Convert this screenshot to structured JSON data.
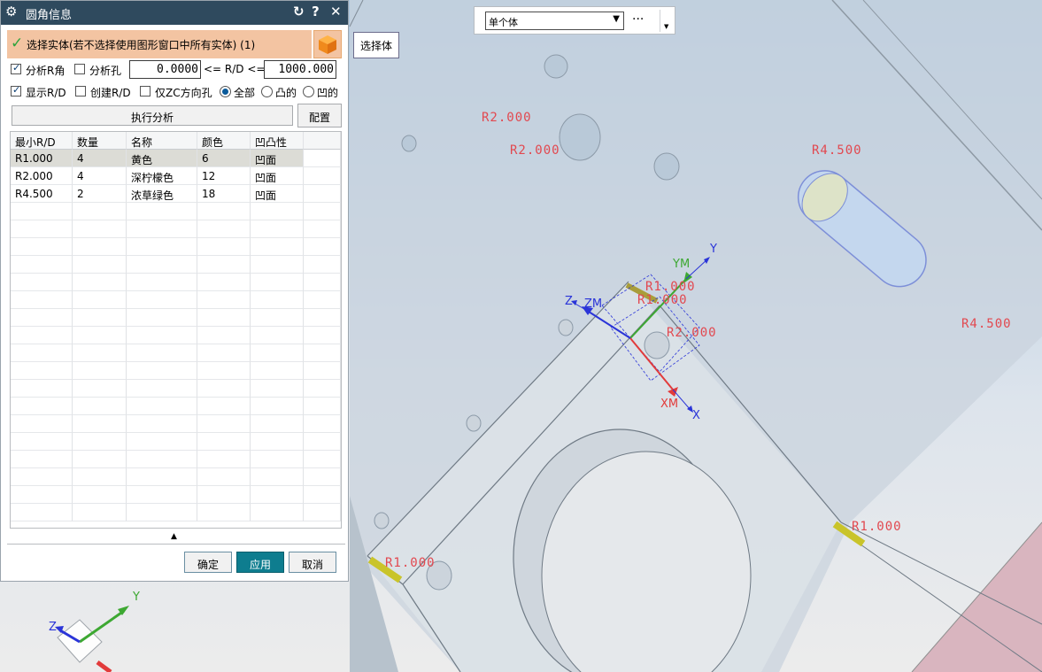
{
  "dialog": {
    "title": "圆角信息",
    "reset_icon": "↻",
    "help_icon": "?",
    "close_icon": "✕",
    "select_label": "选择实体(若不选择使用图形窗口中所有实体) (1)",
    "options": {
      "analyze_r": {
        "label": "分析R角",
        "checked": true
      },
      "analyze_hole": {
        "label": "分析孔",
        "checked": false
      },
      "min_value": "0.0000",
      "range_op1": "<= R/D <=",
      "max_value": "1000.000",
      "show_rd": {
        "label": "显示R/D",
        "checked": true
      },
      "create_rd": {
        "label": "创建R/D",
        "checked": false
      },
      "zc_only": {
        "label": "仅ZC方向孔",
        "checked": false
      },
      "radio_all": {
        "label": "全部",
        "selected": true
      },
      "radio_convex": {
        "label": "凸的",
        "selected": false
      },
      "radio_concave": {
        "label": "凹的",
        "selected": false
      }
    },
    "run_button": "执行分析",
    "config_button": "配置",
    "table": {
      "headers": [
        "最小R/D",
        "数量",
        "名称",
        "颜色",
        "凹凸性"
      ],
      "rows": [
        [
          "R1.000",
          "4",
          "黄色",
          "6",
          "凹面"
        ],
        [
          "R2.000",
          "4",
          "深柠檬色",
          "12",
          "凹面"
        ],
        [
          "R4.500",
          "2",
          "浓草绿色",
          "18",
          "凹面"
        ]
      ]
    },
    "collapse_arrow": "▲",
    "ok_button": "确定",
    "apply_button": "应用",
    "cancel_button": "取消"
  },
  "toolbar": {
    "filter_value": "单个体",
    "more_label": "···"
  },
  "tooltip": "选择体",
  "viewport": {
    "dims": {
      "d1": "R2.000",
      "d2": "R2.000",
      "d3": "R4.500",
      "d4": "R4.500",
      "d5": "R1.000",
      "d6": "R1.000",
      "d7": "R2.000",
      "d8": "R1.000",
      "d9": "R1.000"
    },
    "axes": {
      "y": "Y",
      "ym": "YM",
      "z": "Z",
      "zm": "ZM",
      "xm": "XM",
      "x": "X"
    },
    "triad": {
      "y": "Y",
      "z": "Z"
    }
  },
  "colors": {
    "accent": "#0e7d8f",
    "title_bar": "#2f4a5e",
    "select_bg": "#f3c4a2",
    "dimension": "#e2484f"
  }
}
